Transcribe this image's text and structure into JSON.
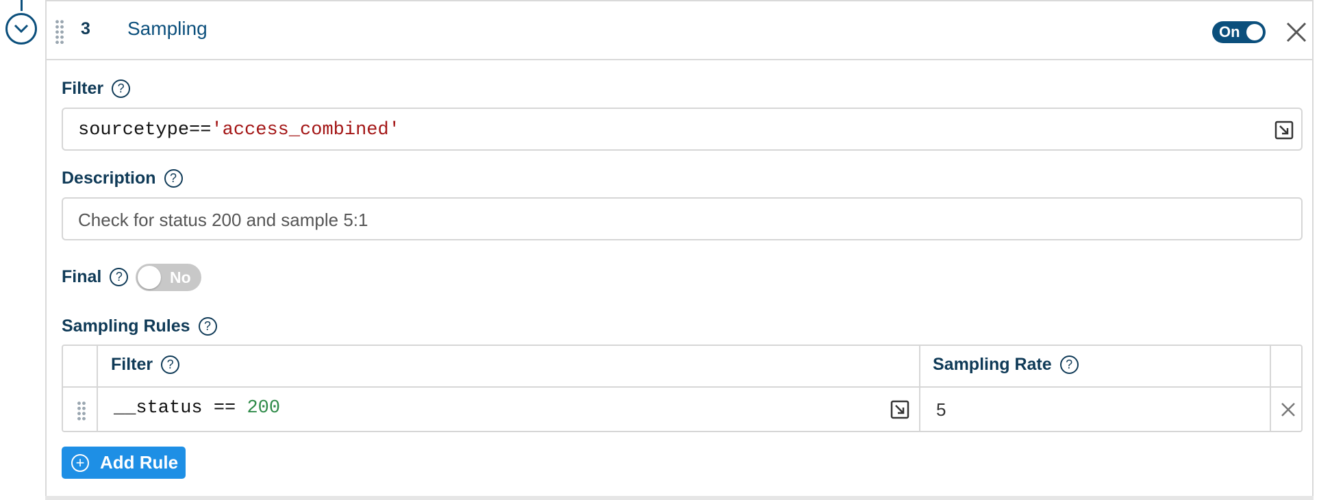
{
  "step": {
    "number": "3",
    "title": "Sampling",
    "enabled_label": "On"
  },
  "filter": {
    "label": "Filter",
    "expr_key": "sourcetype==",
    "expr_value": "'access_combined'"
  },
  "description": {
    "label": "Description",
    "value": "Check for status 200 and sample 5:1"
  },
  "final": {
    "label": "Final",
    "toggle_label": "No"
  },
  "sampling_rules": {
    "label": "Sampling Rules",
    "columns": {
      "filter": "Filter",
      "rate": "Sampling Rate"
    },
    "rows": [
      {
        "filter_key": "__status == ",
        "filter_value": "200",
        "rate": "5"
      }
    ],
    "add_label": "Add Rule"
  },
  "icons": {
    "collapse": "chevron-down-icon",
    "close": "close-icon",
    "expand": "expand-editor-icon",
    "help": "help-icon",
    "add": "plus-circle-icon"
  },
  "colors": {
    "primary": "#0b4f7c",
    "button": "#1e8fe5",
    "string": "#a31515",
    "number": "#2e8a48"
  }
}
